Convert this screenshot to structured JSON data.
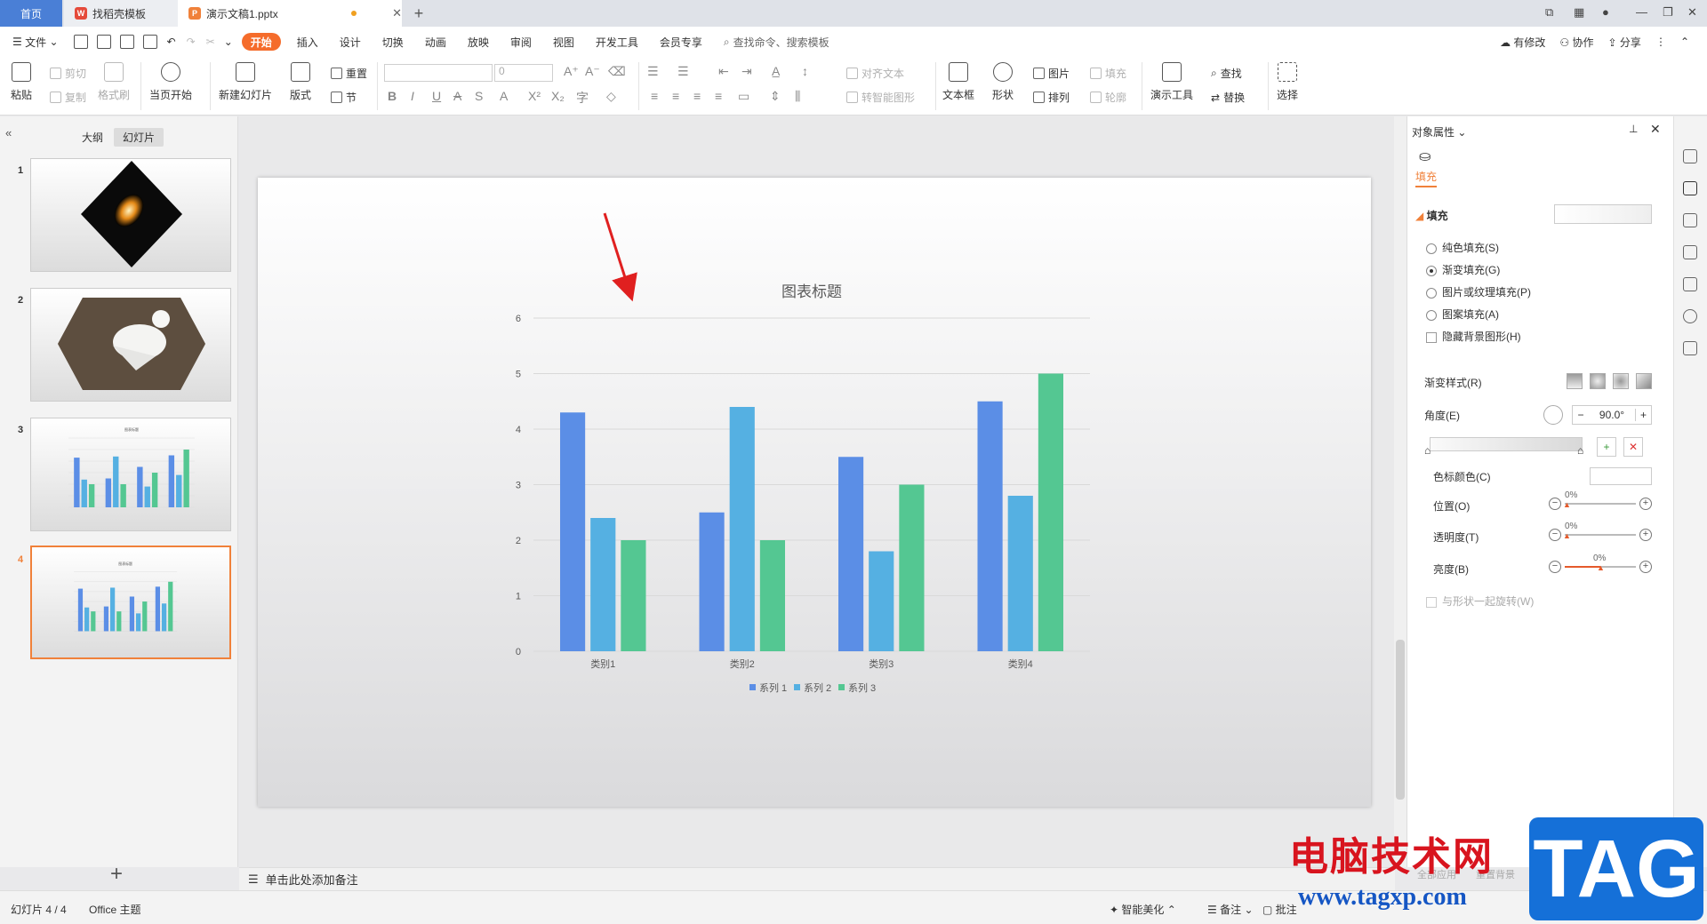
{
  "tabs": {
    "home": "首页",
    "templates": "找稻壳模板",
    "document": "演示文稿1.pptx",
    "add": "+"
  },
  "menu": {
    "file": "文件",
    "items": [
      "开始",
      "插入",
      "设计",
      "切换",
      "动画",
      "放映",
      "审阅",
      "视图",
      "开发工具",
      "会员专享"
    ],
    "search": "查找命令、搜索模板",
    "right": {
      "modified": "有修改",
      "collab": "协作",
      "share": "分享"
    }
  },
  "ribbon": {
    "paste": "粘贴",
    "cut": "剪切",
    "copy": "复制",
    "format_painter": "格式刷",
    "from_current": "当页开始",
    "new_slide": "新建幻灯片",
    "layout": "版式",
    "reset": "重置",
    "section": "节",
    "font_size": "0",
    "align_text": "对齐文本",
    "convert_smartart": "转智能图形",
    "textbox": "文本框",
    "shape": "形状",
    "picture": "图片",
    "arrange": "排列",
    "fill": "填充",
    "outline": "轮廓",
    "present_tool": "演示工具",
    "find": "查找",
    "replace": "替换",
    "select": "选择"
  },
  "left_panel": {
    "outline": "大纲",
    "slides": "幻灯片",
    "slide_numbers": [
      "1",
      "2",
      "3",
      "4"
    ],
    "thumb_title": "图表标题"
  },
  "notes_placeholder": "单击此处添加备注",
  "chart_data": {
    "type": "bar",
    "title": "图表标题",
    "categories": [
      "类别1",
      "类别2",
      "类别3",
      "类别4"
    ],
    "series": [
      {
        "name": "系列 1",
        "values": [
          4.3,
          2.5,
          3.5,
          4.5
        ],
        "color": "#5b8ee6"
      },
      {
        "name": "系列 2",
        "values": [
          2.4,
          4.4,
          1.8,
          2.8
        ],
        "color": "#55b0e2"
      },
      {
        "name": "系列 3",
        "values": [
          2.0,
          2.0,
          3.0,
          5.0
        ],
        "color": "#54c792"
      }
    ],
    "yticks": [
      "0",
      "1",
      "2",
      "3",
      "4",
      "5",
      "6"
    ],
    "ylim": [
      0,
      6
    ],
    "grid": true,
    "legend": "bottom"
  },
  "right_panel": {
    "title": "对象属性",
    "tab_fill": "填充",
    "section": "填充",
    "options": [
      "纯色填充(S)",
      "渐变填充(G)",
      "图片或纹理填充(P)",
      "图案填充(A)"
    ],
    "selected_option": 1,
    "hide_bg": "隐藏背景图形(H)",
    "gradient_style": "渐变样式(R)",
    "angle_label": "角度(E)",
    "angle_value": "90.0°",
    "stop_color": "色标颜色(C)",
    "position_label": "位置(O)",
    "position_value": "0%",
    "transparency_label": "透明度(T)",
    "transparency_value": "0%",
    "brightness_label": "亮度(B)",
    "brightness_value": "0%",
    "rotate_with_shape": "与形状一起旋转(W)",
    "apply_all": "全部应用",
    "reset_bg": "重置背景"
  },
  "status": {
    "slide": "幻灯片 4 / 4",
    "theme": "Office 主题",
    "beautify": "智能美化",
    "notes": "备注",
    "comment": "批注"
  },
  "watermark": {
    "site_name": "电脑技术网",
    "url": "www.tagxp.com",
    "tag": "TAG"
  },
  "colors": {
    "accent": "#f56c2b",
    "home_tab": "#4a7fd6",
    "arrow": "#e02020"
  }
}
